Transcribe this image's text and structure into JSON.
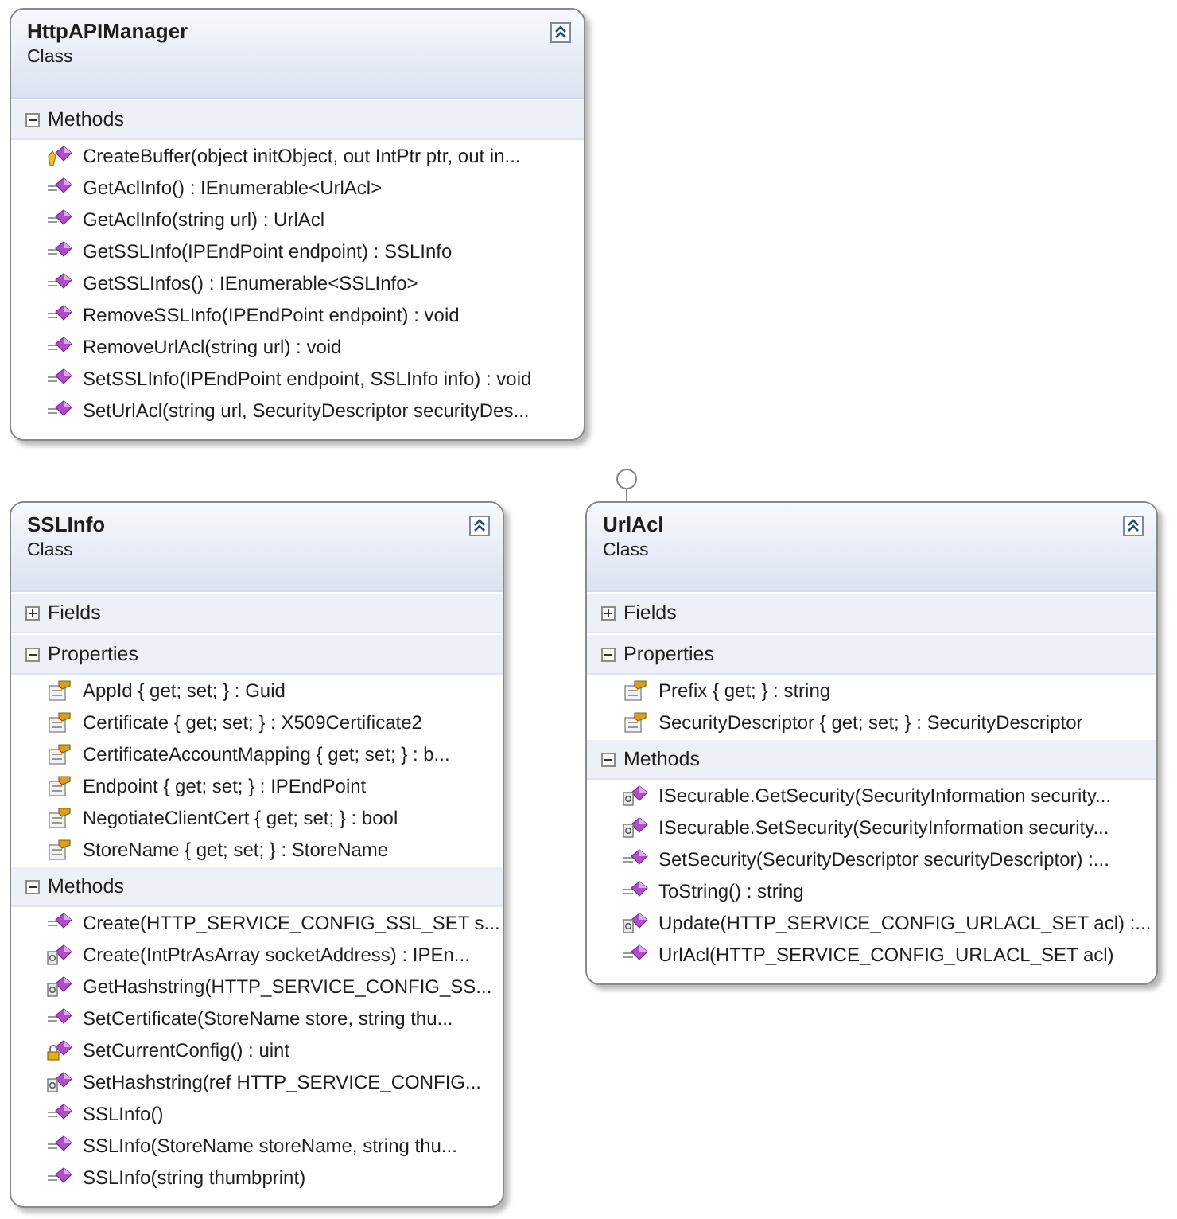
{
  "classes": [
    {
      "name": "HttpAPIManager",
      "stereotype": "Class",
      "lollipop": false,
      "sections": [
        {
          "title": "Methods",
          "expanded": true,
          "members": [
            {
              "kind": "protected-method",
              "text": "CreateBuffer(object initObject, out IntPtr ptr, out in..."
            },
            {
              "kind": "public-method",
              "text": "GetAclInfo() : IEnumerable<UrlAcl>"
            },
            {
              "kind": "public-method",
              "text": "GetAclInfo(string url) : UrlAcl"
            },
            {
              "kind": "public-method",
              "text": "GetSSLInfo(IPEndPoint endpoint) : SSLInfo"
            },
            {
              "kind": "public-method",
              "text": "GetSSLInfos() : IEnumerable<SSLInfo>"
            },
            {
              "kind": "public-method",
              "text": "RemoveSSLInfo(IPEndPoint endpoint) : void"
            },
            {
              "kind": "public-method",
              "text": "RemoveUrlAcl(string url) : void"
            },
            {
              "kind": "public-method",
              "text": "SetSSLInfo(IPEndPoint endpoint, SSLInfo info) : void"
            },
            {
              "kind": "public-method",
              "text": "SetUrlAcl(string url, SecurityDescriptor securityDes..."
            }
          ]
        }
      ]
    },
    {
      "name": "SSLInfo",
      "stereotype": "Class",
      "lollipop": false,
      "sections": [
        {
          "title": "Fields",
          "expanded": false
        },
        {
          "title": "Properties",
          "expanded": true,
          "members": [
            {
              "kind": "property",
              "text": "AppId { get; set; } : Guid"
            },
            {
              "kind": "property",
              "text": "Certificate { get; set; } : X509Certificate2"
            },
            {
              "kind": "property",
              "text": "CertificateAccountMapping { get; set; } : b..."
            },
            {
              "kind": "property",
              "text": "Endpoint { get; set; } : IPEndPoint"
            },
            {
              "kind": "property",
              "text": "NegotiateClientCert { get; set; } : bool"
            },
            {
              "kind": "property",
              "text": "StoreName { get; set; } : StoreName"
            }
          ]
        },
        {
          "title": "Methods",
          "expanded": true,
          "members": [
            {
              "kind": "public-method",
              "text": "Create(HTTP_SERVICE_CONFIG_SSL_SET  s..."
            },
            {
              "kind": "internal-method",
              "text": "Create(IntPtrAsArray socketAddress) : IPEn..."
            },
            {
              "kind": "internal-method",
              "text": "GetHashstring(HTTP_SERVICE_CONFIG_SS..."
            },
            {
              "kind": "public-method",
              "text": "SetCertificate(StoreName store, string thu..."
            },
            {
              "kind": "private-method",
              "text": "SetCurrentConfig() : uint"
            },
            {
              "kind": "internal-method",
              "text": "SetHashstring(ref  HTTP_SERVICE_CONFIG..."
            },
            {
              "kind": "public-method",
              "text": "SSLInfo()"
            },
            {
              "kind": "public-method",
              "text": "SSLInfo(StoreName storeName, string thu..."
            },
            {
              "kind": "public-method",
              "text": "SSLInfo(string thumbprint)"
            }
          ]
        }
      ]
    },
    {
      "name": "UrlAcl",
      "stereotype": "Class",
      "lollipop": true,
      "sections": [
        {
          "title": "Fields",
          "expanded": false
        },
        {
          "title": "Properties",
          "expanded": true,
          "members": [
            {
              "kind": "property",
              "text": "Prefix { get; } : string"
            },
            {
              "kind": "property",
              "text": "SecurityDescriptor { get; set; } : SecurityDescriptor"
            }
          ]
        },
        {
          "title": "Methods",
          "expanded": true,
          "members": [
            {
              "kind": "internal-method",
              "text": "ISecurable.GetSecurity(SecurityInformation  security..."
            },
            {
              "kind": "internal-method",
              "text": "ISecurable.SetSecurity(SecurityInformation  security..."
            },
            {
              "kind": "public-method",
              "text": "SetSecurity(SecurityDescriptor securityDescriptor) :..."
            },
            {
              "kind": "public-method",
              "text": "ToString() : string"
            },
            {
              "kind": "internal-method",
              "text": "Update(HTTP_SERVICE_CONFIG_URLACL_SET  acl)  :..."
            },
            {
              "kind": "public-method",
              "text": "UrlAcl(HTTP_SERVICE_CONFIG_URLACL_SET acl)"
            }
          ]
        }
      ]
    }
  ]
}
